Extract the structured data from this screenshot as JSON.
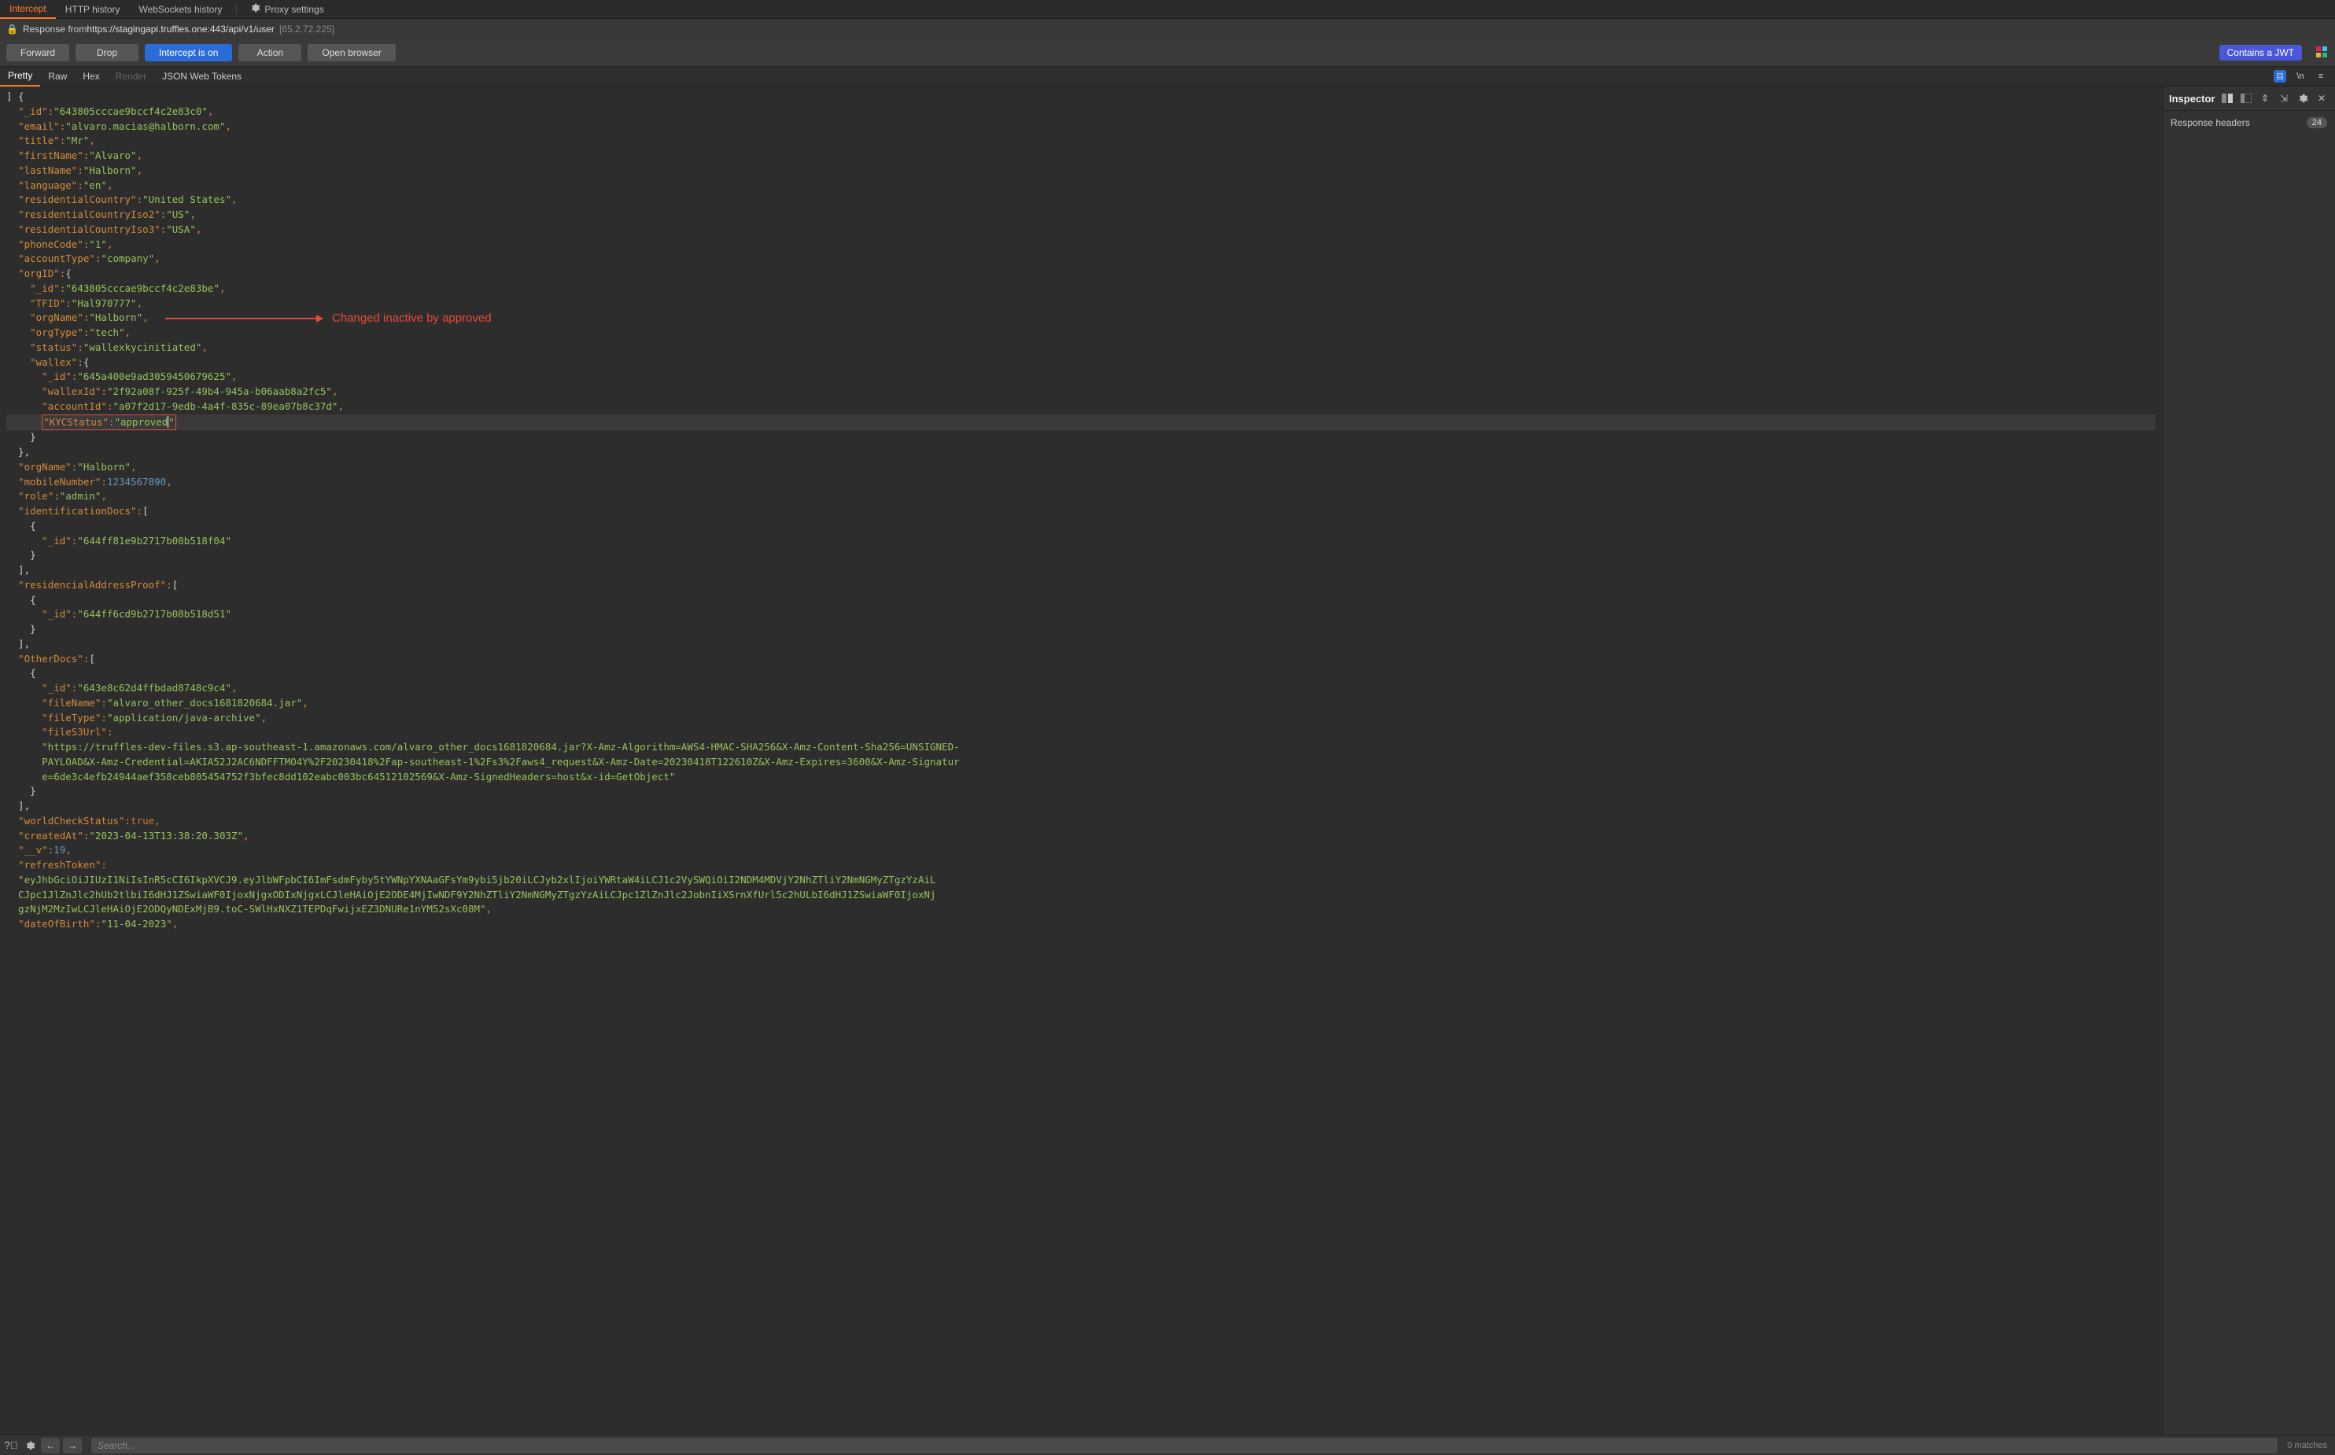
{
  "top_tabs": {
    "intercept": "Intercept",
    "http_history": "HTTP history",
    "ws_history": "WebSockets history",
    "proxy_settings": "Proxy settings"
  },
  "info_bar": {
    "prefix": "Response from ",
    "url": "https://stagingapi.truffles.one:443/api/v1/user",
    "ip": "[65.2.72.225]"
  },
  "action_bar": {
    "forward": "Forward",
    "drop": "Drop",
    "intercept": "Intercept is on",
    "action": "Action",
    "open_browser": "Open browser",
    "jwt_badge": "Contains a JWT"
  },
  "view_tabs": {
    "pretty": "Pretty",
    "raw": "Raw",
    "hex": "Hex",
    "render": "Render",
    "jwt": "JSON Web Tokens",
    "newline_label": "\\n"
  },
  "inspector": {
    "title": "Inspector",
    "response_headers": "Response headers",
    "response_headers_count": "24"
  },
  "bottom_bar": {
    "search_placeholder": "Search...",
    "matches": "0 matches"
  },
  "annotation": {
    "text": "Changed inactive by approved"
  },
  "response_json": {
    "opening": "] {",
    "fields": [
      {
        "key": "\"_id\"",
        "val": "\"643805cccae9bccf4c2e83c0\"",
        "t": "s",
        "ind": 1,
        "comma": true
      },
      {
        "key": "\"email\"",
        "val": "\"alvaro.macias@halborn.com\"",
        "t": "s",
        "ind": 1,
        "comma": true
      },
      {
        "key": "\"title\"",
        "val": "\"Mr\"",
        "t": "s",
        "ind": 1,
        "comma": true
      },
      {
        "key": "\"firstName\"",
        "val": "\"Alvaro\"",
        "t": "s",
        "ind": 1,
        "comma": true
      },
      {
        "key": "\"lastName\"",
        "val": "\"Halborn\"",
        "t": "s",
        "ind": 1,
        "comma": true
      },
      {
        "key": "\"language\"",
        "val": "\"en\"",
        "t": "s",
        "ind": 1,
        "comma": true
      },
      {
        "key": "\"residentialCountry\"",
        "val": "\"United States\"",
        "t": "s",
        "ind": 1,
        "comma": true
      },
      {
        "key": "\"residentialCountryIso2\"",
        "val": "\"US\"",
        "t": "s",
        "ind": 1,
        "comma": true
      },
      {
        "key": "\"residentialCountryIso3\"",
        "val": "\"USA\"",
        "t": "s",
        "ind": 1,
        "comma": true
      },
      {
        "key": "\"phoneCode\"",
        "val": "\"1\"",
        "t": "s",
        "ind": 1,
        "comma": true
      },
      {
        "key": "\"accountType\"",
        "val": "\"company\"",
        "t": "s",
        "ind": 1,
        "comma": true
      },
      {
        "key": "\"orgID\"",
        "val": "{",
        "t": "open",
        "ind": 1
      },
      {
        "key": "\"_id\"",
        "val": "\"643805cccae9bccf4c2e83be\"",
        "t": "s",
        "ind": 2,
        "comma": true
      },
      {
        "key": "\"TFID\"",
        "val": "\"Hal970777\"",
        "t": "s",
        "ind": 2,
        "comma": true
      },
      {
        "key": "\"orgName\"",
        "val": "\"Halborn\"",
        "t": "s",
        "ind": 2,
        "comma": true
      },
      {
        "key": "\"orgType\"",
        "val": "\"tech\"",
        "t": "s",
        "ind": 2,
        "comma": true
      },
      {
        "key": "\"status\"",
        "val": "\"wallexkycinitiated\"",
        "t": "s",
        "ind": 2,
        "comma": true
      },
      {
        "key": "\"wallex\"",
        "val": "{",
        "t": "open",
        "ind": 2
      },
      {
        "key": "\"_id\"",
        "val": "\"645a400e9ad3059450679625\"",
        "t": "s",
        "ind": 3,
        "comma": true
      },
      {
        "key": "\"wallexId\"",
        "val": "\"2f92a08f-925f-49b4-945a-b06aab8a2fc5\"",
        "t": "s",
        "ind": 3,
        "comma": true
      },
      {
        "key": "\"accountId\"",
        "val": "\"a07f2d17-9edb-4a4f-835c-89ea07b8c37d\"",
        "t": "s",
        "ind": 3,
        "comma": true
      },
      {
        "key": "\"KYCStatus\"",
        "val": "\"approved\"",
        "t": "s",
        "ind": 3,
        "hl": true,
        "caret_val": "approved"
      },
      {
        "close": "}",
        "ind": 2
      },
      {
        "close": "},",
        "ind": 1
      },
      {
        "key": "\"orgName\"",
        "val": "\"Halborn\"",
        "t": "s",
        "ind": 1,
        "comma": true
      },
      {
        "key": "\"mobileNumber\"",
        "val": "1234567890",
        "t": "n",
        "ind": 1,
        "comma": true
      },
      {
        "key": "\"role\"",
        "val": "\"admin\"",
        "t": "s",
        "ind": 1,
        "comma": true
      },
      {
        "key": "\"identificationDocs\"",
        "val": "[",
        "t": "open",
        "ind": 1
      },
      {
        "raw": "{",
        "ind": 2
      },
      {
        "key": "\"_id\"",
        "val": "\"644ff81e9b2717b08b518f04\"",
        "t": "s",
        "ind": 3
      },
      {
        "raw": "}",
        "ind": 2
      },
      {
        "close": "],",
        "ind": 1
      },
      {
        "key": "\"residencialAddressProof\"",
        "val": "[",
        "t": "open",
        "ind": 1
      },
      {
        "raw": "{",
        "ind": 2
      },
      {
        "key": "\"_id\"",
        "val": "\"644ff6cd9b2717b08b518d51\"",
        "t": "s",
        "ind": 3
      },
      {
        "raw": "}",
        "ind": 2
      },
      {
        "close": "],",
        "ind": 1
      },
      {
        "key": "\"OtherDocs\"",
        "val": "[",
        "t": "open",
        "ind": 1
      },
      {
        "raw": "{",
        "ind": 2
      },
      {
        "key": "\"_id\"",
        "val": "\"643e8c62d4ffbdad8748c9c4\"",
        "t": "s",
        "ind": 3,
        "comma": true
      },
      {
        "key": "\"fileName\"",
        "val": "\"alvaro_other_docs1681820684.jar\"",
        "t": "s",
        "ind": 3,
        "comma": true
      },
      {
        "key": "\"fileType\"",
        "val": "\"application/java-archive\"",
        "t": "s",
        "ind": 3,
        "comma": true
      },
      {
        "key": "\"fileS3Url\"",
        "val": "",
        "t": "open_str",
        "ind": 3
      },
      {
        "longstr": "\"https://truffles-dev-files.s3.ap-southeast-1.amazonaws.com/alvaro_other_docs1681820684.jar?X-Amz-Algorithm=AWS4-HMAC-SHA256&X-Amz-Content-Sha256=UNSIGNED-PAYLOAD&X-Amz-Credential=AKIA52J2AC6NDFFTMO4Y%2F20230418%2Fap-southeast-1%2Fs3%2Faws4_request&X-Amz-Date=20230418T122610Z&X-Amz-Expires=3600&X-Amz-Signature=6de3c4efb24944aef358ceb805454752f3bfec8dd102eabc003bc64512102569&X-Amz-SignedHeaders=host&x-id=GetObject\"",
        "ind": 3
      },
      {
        "raw": "}",
        "ind": 2
      },
      {
        "close": "],",
        "ind": 1
      },
      {
        "key": "\"worldCheckStatus\"",
        "val": "true",
        "t": "b",
        "ind": 1,
        "comma": true
      },
      {
        "key": "\"createdAt\"",
        "val": "\"2023-04-13T13:38:20.303Z\"",
        "t": "s",
        "ind": 1,
        "comma": true
      },
      {
        "key": "\"__v\"",
        "val": "19",
        "t": "n",
        "ind": 1,
        "comma": true
      },
      {
        "key": "\"refreshToken\"",
        "val": "",
        "t": "open_str",
        "ind": 1
      },
      {
        "longstr": "\"eyJhbGciOiJIUzI1NiIsInR5cCI6IkpXVCJ9.eyJlbWFpbCI6ImFsdmFyby5tYWNpYXNAaGFsYm9ybi5jb20iLCJyb2xlIjoiYWRtaW4iLCJ1c2VySWQiOiI2NDM4MDVjY2NhZTliY2NmNGMyZTgzYzAiLCJpc1JlZnJlc2hUb2tlbiI6dHJ1ZSwiaWF0IjoxNjgxODIxNjgxLCJleHAiOjE2ODE4MjIwNDF9Y2NhZTliY2NmNGMyZTgzYzAiLCJpc1ZlZnJlc2JobnIiXSrnXfUrl5c2hULbI6dHJ1ZSwiaWF0IjoxNjgzNjM2MzIwLCJleHAiOjE2ODQyNDExMjB9.toC-SWlHxNXZ1TEPDqFwijxEZ3DNURe1nYM52sXc08M\"",
        "ind": 1,
        "comma": true
      },
      {
        "key": "\"dateOfBirth\"",
        "val": "\"11-04-2023\"",
        "t": "s",
        "ind": 1,
        "comma": true
      }
    ]
  }
}
